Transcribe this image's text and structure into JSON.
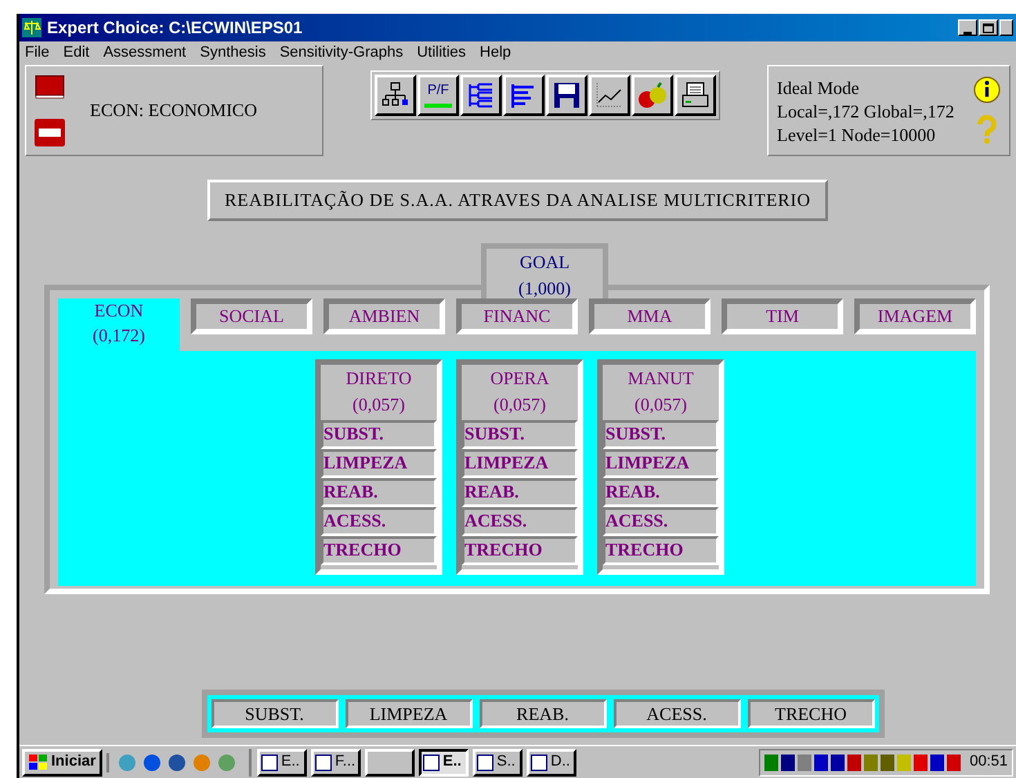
{
  "window": {
    "title": "Expert Choice: C:\\ECWIN\\EPS01"
  },
  "menu": [
    "File",
    "Edit",
    "Assessment",
    "Synthesis",
    "Sensitivity-Graphs",
    "Utilities",
    "Help"
  ],
  "node_label": "ECON: ECONOMICO",
  "toolbar": [
    {
      "kind": "tree"
    },
    {
      "kind": "pf",
      "text": "P/F"
    },
    {
      "kind": "hier"
    },
    {
      "kind": "bars"
    },
    {
      "kind": "save"
    },
    {
      "kind": "graph"
    },
    {
      "kind": "fruit"
    },
    {
      "kind": "print"
    }
  ],
  "status": {
    "mode": "Ideal Mode",
    "priorities": "Local=,172 Global=,172",
    "position": "Level=1  Node=10000"
  },
  "model_title": "REABILITAÇÃO DE S.A.A. ATRAVES DA ANALISE MULTICRITERIO",
  "goal": {
    "label": "GOAL",
    "value": "(1,000)"
  },
  "criteria": [
    {
      "label": "ECON",
      "value": "(0,172)",
      "selected": true
    },
    {
      "label": "SOCIAL",
      "selected": false
    },
    {
      "label": "AMBIEN",
      "selected": false
    },
    {
      "label": "FINANC",
      "selected": false
    },
    {
      "label": "MMA",
      "selected": false
    },
    {
      "label": "TIM",
      "selected": false
    },
    {
      "label": "IMAGEM",
      "selected": false
    }
  ],
  "subcriteria": [
    {
      "label": "DIRETO",
      "value": "(0,057)",
      "alternatives": [
        "SUBST.",
        "LIMPEZA",
        "REAB.",
        "ACESS.",
        "TRECHO"
      ]
    },
    {
      "label": "OPERA",
      "value": "(0,057)",
      "alternatives": [
        "SUBST.",
        "LIMPEZA",
        "REAB.",
        "ACESS.",
        "TRECHO"
      ]
    },
    {
      "label": "MANUT",
      "value": "(0,057)",
      "alternatives": [
        "SUBST.",
        "LIMPEZA",
        "REAB.",
        "ACESS.",
        "TRECHO"
      ]
    }
  ],
  "alternatives_bar": [
    "SUBST.",
    "LIMPEZA",
    "REAB.",
    "ACESS.",
    "TRECHO"
  ],
  "taskbar": {
    "start": "Iniciar",
    "tasks": [
      {
        "text": "E..",
        "selected": false
      },
      {
        "text": "F...",
        "selected": false
      },
      {
        "selected": false
      },
      {
        "text": "E..",
        "selected": true
      },
      {
        "text": "S..",
        "selected": false
      },
      {
        "text": "D..",
        "selected": false
      }
    ],
    "clock": "00:51"
  }
}
